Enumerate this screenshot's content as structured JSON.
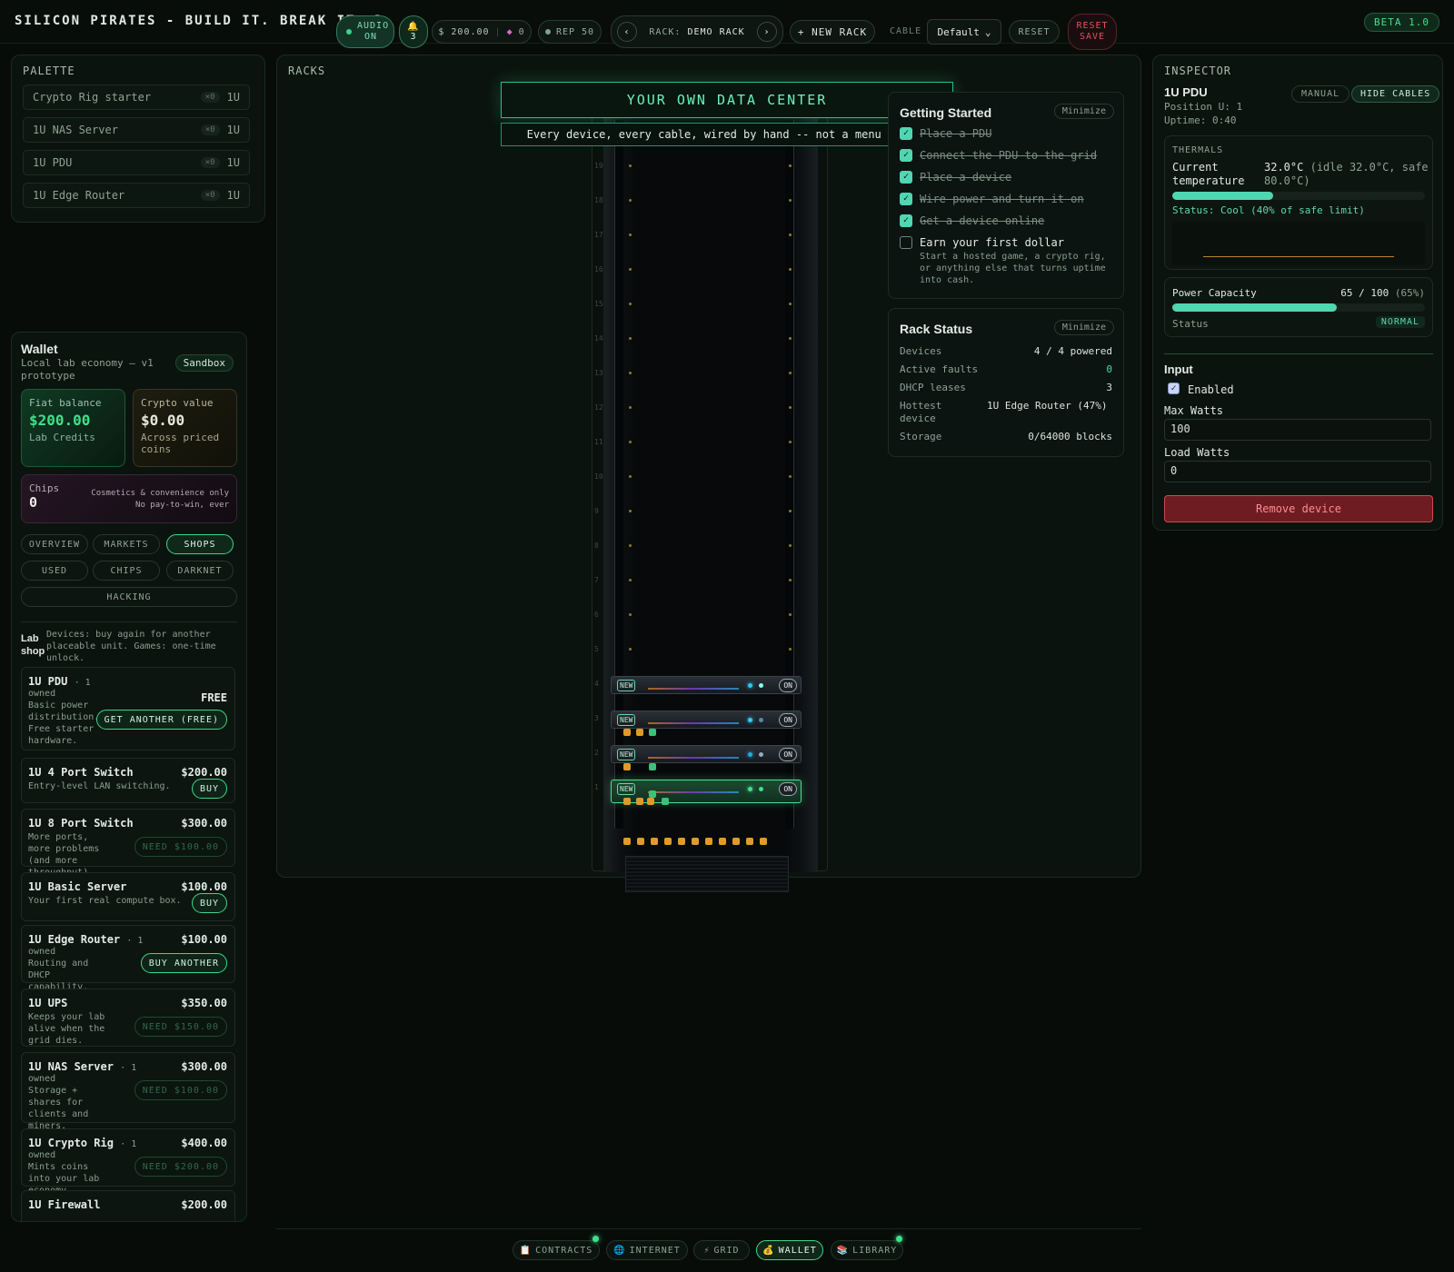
{
  "topbar": {
    "title": "SILICON PIRATES - BUILD IT. BREAK IT. D",
    "audio_label": "AUDIO ON",
    "bell_count": "3",
    "money": "$ 200.00",
    "gems": "0",
    "rep": "REP 50",
    "rack_label": "RACK:",
    "rack_name": "DEMO RACK",
    "new_rack": "+ NEW RACK",
    "cable_label": "CABLE",
    "cable_value": "Default",
    "reset": "RESET",
    "reset_save": "RESET SAVE",
    "beta": "BETA 1.0"
  },
  "palette": {
    "title": "PALETTE",
    "items": [
      {
        "name": "Crypto Rig starter",
        "count": "×0",
        "size": "1U"
      },
      {
        "name": "1U NAS Server",
        "count": "×0",
        "size": "1U"
      },
      {
        "name": "1U PDU",
        "count": "×0",
        "size": "1U"
      },
      {
        "name": "1U Edge Router",
        "count": "×0",
        "size": "1U"
      }
    ]
  },
  "wallet": {
    "title": "Wallet",
    "subtitle": "Local lab economy — v1 prototype",
    "mode": "Sandbox",
    "fiat_label": "Fiat balance",
    "fiat_value": "$200.00",
    "fiat_unit": "Lab Credits",
    "crypto_label": "Crypto value",
    "crypto_value": "$0.00",
    "crypto_unit": "Across priced coins",
    "chips_label": "Chips",
    "chips_value": "0",
    "chips_note1": "Cosmetics & convenience only",
    "chips_note2": "No pay-to-win, ever",
    "tabs": [
      "OVERVIEW",
      "MARKETS",
      "SHOPS",
      "USED",
      "CHIPS",
      "DARKNET",
      "HACKING"
    ],
    "active_tab": "SHOPS",
    "shop_title": "Lab shop",
    "shop_note": "Devices: buy again for another placeable unit. Games: one-time unlock.",
    "shop": [
      {
        "name": "1U PDU",
        "owned": "· 1",
        "owned2": "owned",
        "desc": "Basic power distribution. Free starter hardware.",
        "price": "FREE",
        "button": "GET ANOTHER (FREE)"
      },
      {
        "name": "1U 4 Port Switch",
        "owned": "",
        "owned2": "",
        "desc": "Entry-level LAN switching.",
        "price": "$200.00",
        "button": "BUY"
      },
      {
        "name": "1U 8 Port Switch",
        "owned": "",
        "owned2": "",
        "desc": "More ports, more problems (and more throughput).",
        "price": "$300.00",
        "button": "NEED $100.00"
      },
      {
        "name": "1U Basic Server",
        "owned": "",
        "owned2": "",
        "desc": "Your first real compute box.",
        "price": "$100.00",
        "button": "BUY"
      },
      {
        "name": "1U Edge Router",
        "owned": "· 1",
        "owned2": "owned",
        "desc": "Routing and DHCP capability.",
        "price": "$100.00",
        "button": "BUY ANOTHER"
      },
      {
        "name": "1U UPS",
        "owned": "",
        "owned2": "",
        "desc": "Keeps your lab alive when the grid dies.",
        "price": "$350.00",
        "button": "NEED $150.00"
      },
      {
        "name": "1U NAS Server",
        "owned": "· 1",
        "owned2": "owned",
        "desc": "Storage + shares for clients and miners.",
        "price": "$300.00",
        "button": "NEED $100.00"
      },
      {
        "name": "1U Crypto Rig",
        "owned": "· 1",
        "owned2": "owned",
        "desc": "Mints coins into your lab economy.",
        "price": "$400.00",
        "button": "NEED $200.00"
      },
      {
        "name": "1U Firewall",
        "owned": "",
        "owned2": "",
        "desc": "",
        "price": "$200.00",
        "button": ""
      }
    ]
  },
  "racks": {
    "title": "RACKS",
    "banner": "YOUR OWN DATA CENTER",
    "tagline": "Every device, every cable, wired by hand -- not a menu toggle",
    "units": [
      "19",
      "18",
      "17",
      "16",
      "15",
      "14",
      "13",
      "12",
      "11",
      "10",
      "9",
      "8",
      "7",
      "6",
      "5",
      "4",
      "3",
      "2",
      "1"
    ],
    "devices": [
      {
        "u": "4",
        "tag": "NEW",
        "state": "ON"
      },
      {
        "u": "3",
        "tag": "NEW",
        "state": "ON"
      },
      {
        "u": "2",
        "tag": "NEW",
        "state": "ON"
      },
      {
        "u": "1",
        "tag": "NEW",
        "state": "ON"
      }
    ]
  },
  "getting_started": {
    "title": "Getting Started",
    "minimize": "Minimize",
    "tasks": [
      {
        "label": "Place a PDU",
        "done": true
      },
      {
        "label": "Connect the PDU to the grid",
        "done": true
      },
      {
        "label": "Place a device",
        "done": true
      },
      {
        "label": "Wire power and turn it on",
        "done": true
      },
      {
        "label": "Get a device online",
        "done": true
      },
      {
        "label": "Earn your first dollar",
        "done": false
      }
    ],
    "last_desc": "Start a hosted game, a crypto rig, or anything else that turns uptime into cash."
  },
  "rack_status": {
    "title": "Rack Status",
    "minimize": "Minimize",
    "rows": [
      {
        "label": "Devices",
        "value": "4 / 4 powered"
      },
      {
        "label": "Active faults",
        "value": "0"
      },
      {
        "label": "DHCP leases",
        "value": "3"
      },
      {
        "label": "Hottest device",
        "value": "1U Edge Router (47%)"
      },
      {
        "label": "Storage",
        "value": "0/64000 blocks"
      }
    ]
  },
  "inspector": {
    "title": "INSPECTOR",
    "device": "1U PDU",
    "position": "Position U: 1",
    "uptime": "Uptime: 0:40",
    "manual": "MANUAL",
    "hide_cables": "HIDE CABLES",
    "thermals_title": "THERMALS",
    "current_label": "Current temperature",
    "current_value": "32.0°C",
    "current_detail": "(idle 32.0°C, safe 80.0°C)",
    "temp_fraction": 0.4,
    "thermal_status": "Status: Cool (40% of safe limit)",
    "power_label": "Power Capacity",
    "power_value": "65 / 100",
    "power_pct": "(65%)",
    "power_fraction": 0.65,
    "status_label": "Status",
    "status_value": "NORMAL",
    "input_title": "Input",
    "enabled_label": "Enabled",
    "max_watts_label": "Max Watts",
    "max_watts_value": "100",
    "load_watts_label": "Load Watts",
    "load_watts_value": "0",
    "remove": "Remove device"
  },
  "dock": [
    {
      "label": "CONTRACTS",
      "icon": "📋",
      "notify": true
    },
    {
      "label": "INTERNET",
      "icon": "🌐",
      "notify": false
    },
    {
      "label": "GRID",
      "icon": "⚡",
      "notify": false
    },
    {
      "label": "WALLET",
      "icon": "💰",
      "notify": false,
      "active": true
    },
    {
      "label": "LIBRARY",
      "icon": "📚",
      "notify": true
    }
  ],
  "colors": {
    "accent": "#3ed786",
    "danger": "#e0525a",
    "teal": "#4fd6b2"
  }
}
